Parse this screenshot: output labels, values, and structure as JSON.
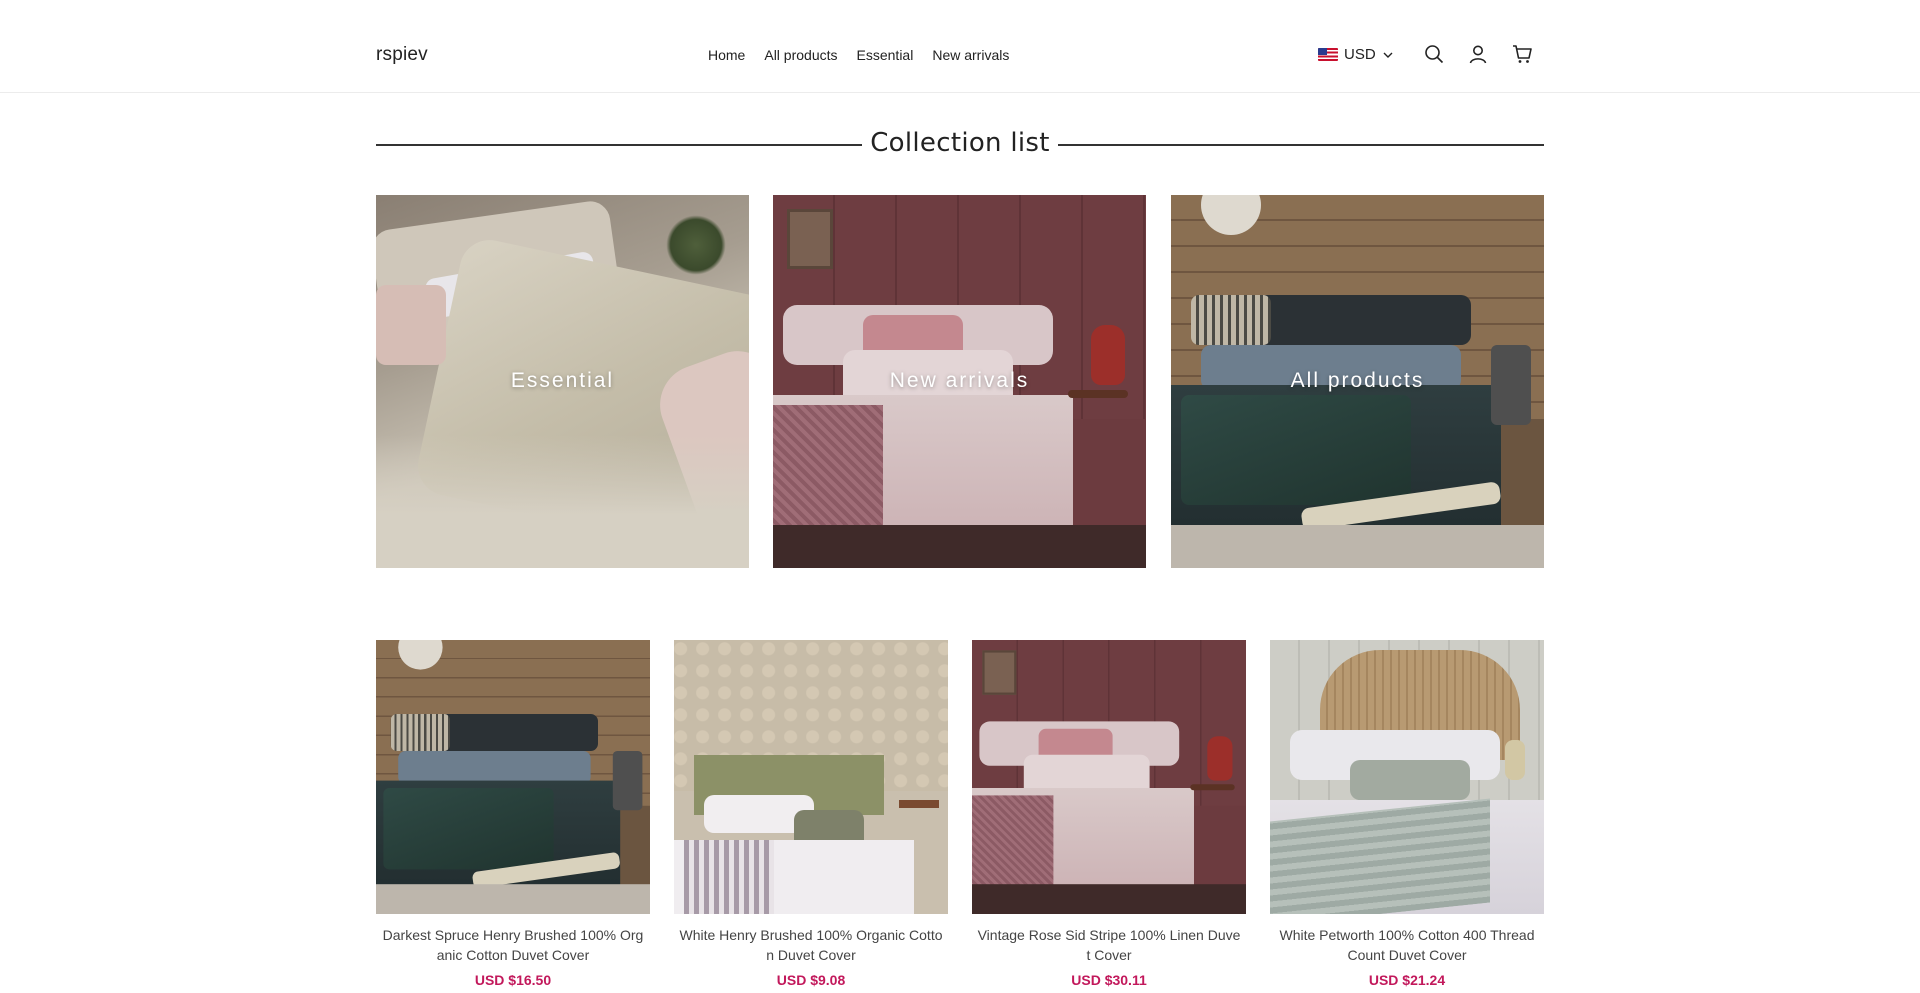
{
  "header": {
    "logo": "rspiev",
    "nav": [
      "Home",
      "All products",
      "Essential",
      "New arrivals"
    ],
    "currency": "USD",
    "icons": [
      "search-icon",
      "account-icon",
      "cart-icon",
      "chevron-down-icon",
      "us-flag-icon"
    ]
  },
  "collection_list": {
    "title": "Collection list",
    "items": [
      {
        "label": "Essential"
      },
      {
        "label": "New arrivals"
      },
      {
        "label": "All products"
      }
    ]
  },
  "products": [
    {
      "name": "Darkest Spruce Henry Brushed 100% Organic Cotton Duvet Cover",
      "price": "USD $16.50"
    },
    {
      "name": "White Henry Brushed 100% Organic Cotton Duvet Cover",
      "price": "USD $9.08"
    },
    {
      "name": "Vintage Rose Sid Stripe 100% Linen Duvet Cover",
      "price": "USD $30.11"
    },
    {
      "name": "White Petworth 100% Cotton 400 Thread Count Duvet Cover",
      "price": "USD $21.24"
    }
  ],
  "colors": {
    "price": "#c2185b",
    "text": "#222222",
    "divider": "#333333"
  }
}
